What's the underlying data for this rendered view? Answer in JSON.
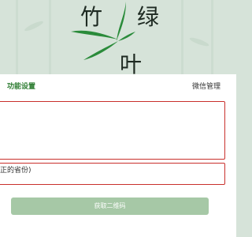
{
  "logo": {
    "char_1": "竹",
    "char_2": "绿",
    "char_3": "叶"
  },
  "tabs": {
    "active_label": "功能设置",
    "other_label": "微信管理"
  },
  "form": {
    "hint_text": "正的省份)",
    "button_label": "获取二维码"
  },
  "colors": {
    "accent": "#2e7d32",
    "border_alert": "#c9302c",
    "button_bg": "#a6c8a6",
    "background": "#d6e3d9"
  }
}
